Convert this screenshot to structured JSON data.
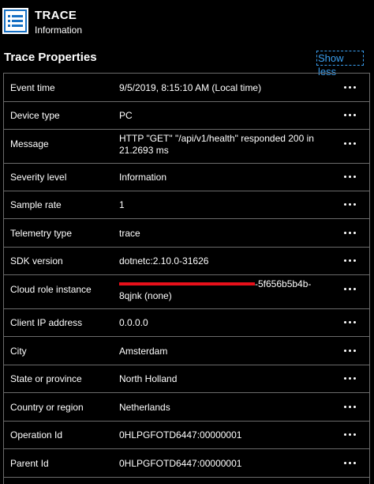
{
  "header": {
    "title": "TRACE",
    "subtitle": "Information",
    "icon": "list-document-icon",
    "accent": "#1570c4"
  },
  "section": {
    "title": "Trace Properties",
    "toggle_label": "Show less",
    "link_color": "#3a9ff0"
  },
  "properties": [
    {
      "label": "Event time",
      "value": "9/5/2019, 8:15:10 AM (Local time)"
    },
    {
      "label": "Device type",
      "value": "PC"
    },
    {
      "label": "Message",
      "value": "HTTP \"GET\" \"/api/v1/health\" responded 200 in 21.2693 ms"
    },
    {
      "label": "Severity level",
      "value": "Information"
    },
    {
      "label": "Sample rate",
      "value": "1"
    },
    {
      "label": "Telemetry type",
      "value": "trace"
    },
    {
      "label": "SDK version",
      "value": "dotnetc:2.10.0-31626"
    },
    {
      "label": "Cloud role instance",
      "value_prefix": "",
      "value_suffix": "-5f656b5b4b-",
      "value_line2": "8qjnk (none)",
      "redacted": true
    },
    {
      "label": "Client IP address",
      "value": "0.0.0.0"
    },
    {
      "label": "City",
      "value": "Amsterdam"
    },
    {
      "label": "State or province",
      "value": "North Holland"
    },
    {
      "label": "Country or region",
      "value": "Netherlands"
    },
    {
      "label": "Operation Id",
      "value": "0HLPGFOTD6447:00000001"
    },
    {
      "label": "Parent Id",
      "value": "0HLPGFOTD6447:00000001"
    }
  ]
}
